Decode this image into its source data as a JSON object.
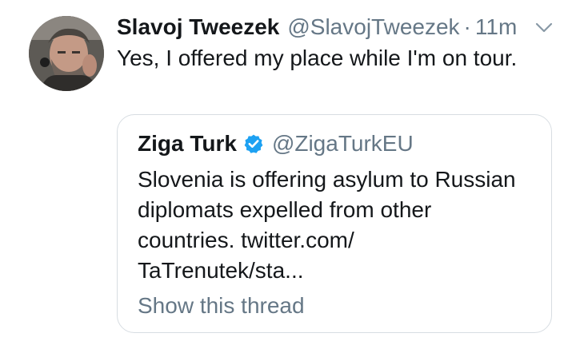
{
  "tweet": {
    "author_name": "Slavoj Tweezek",
    "author_handle": "@SlavojTweezek",
    "separator": "·",
    "time": "11m",
    "menu_icon": "chevron-down-icon",
    "avatar_icon": "profile-photo",
    "text": "Yes, I offered my place while I'm on tour."
  },
  "quoted_tweet": {
    "author_name": "Ziga Turk",
    "verified_icon": "verified-badge-icon",
    "author_handle": "@ZigaTurkEU",
    "text": "Slovenia is offering asylum to Russian diplomats expelled from other countries. twitter.com/ TaTrenutek/sta...",
    "show_thread": "Show this thread"
  },
  "colors": {
    "primary_text": "#14171a",
    "secondary_text": "#657786",
    "verified_blue": "#1da1f2",
    "border": "#d7dde2"
  }
}
